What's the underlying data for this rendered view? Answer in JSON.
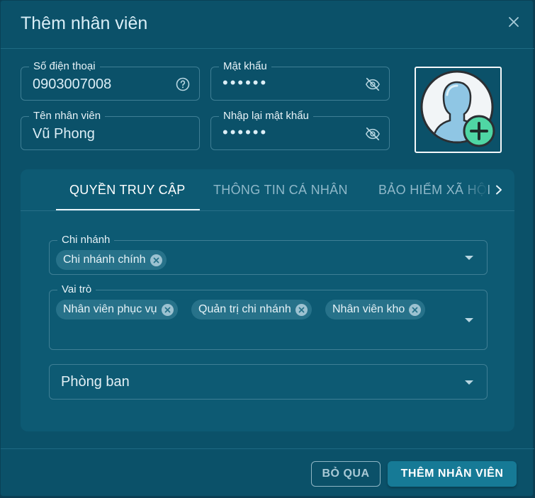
{
  "dialog": {
    "title": "Thêm nhân viên"
  },
  "form": {
    "phone": {
      "label": "Số điện thoại",
      "value": "0903007008"
    },
    "password": {
      "label": "Mật khẩu",
      "value": "••••••"
    },
    "name": {
      "label": "Tên nhân viên",
      "value": "Vũ Phong"
    },
    "confirm_password": {
      "label": "Nhập lại mật khẩu",
      "value": "••••••"
    }
  },
  "tabs": [
    {
      "label": "QUYỀN TRUY CẬP",
      "active": true
    },
    {
      "label": "THÔNG TIN CÁ NHÂN",
      "active": false
    },
    {
      "label": "BẢO HIỂM XÃ HỘI",
      "active": false
    }
  ],
  "access": {
    "branch": {
      "label": "Chi nhánh",
      "chips": [
        "Chi nhánh chính"
      ]
    },
    "role": {
      "label": "Vai trò",
      "chips": [
        "Nhân viên phục vụ",
        "Quản trị chi nhánh",
        "Nhân viên kho"
      ]
    },
    "department": {
      "placeholder": "Phòng ban"
    }
  },
  "footer": {
    "cancel_label": "BỎ QUA",
    "submit_label": "THÊM NHÂN VIÊN"
  },
  "colors": {
    "background": "#0b5169",
    "panel": "#0d5a73",
    "accent": "#167a96",
    "avatar_badge": "#4fd6a4"
  },
  "icons": {
    "close": "close-icon",
    "help": "help-circle-icon",
    "visibility": "eye-off-icon",
    "avatar": "user-avatar-icon",
    "add": "plus-circle-icon",
    "tabs_next": "chevron-right-icon",
    "dropdown": "caret-down-icon",
    "chip_remove": "x-circle-icon"
  }
}
